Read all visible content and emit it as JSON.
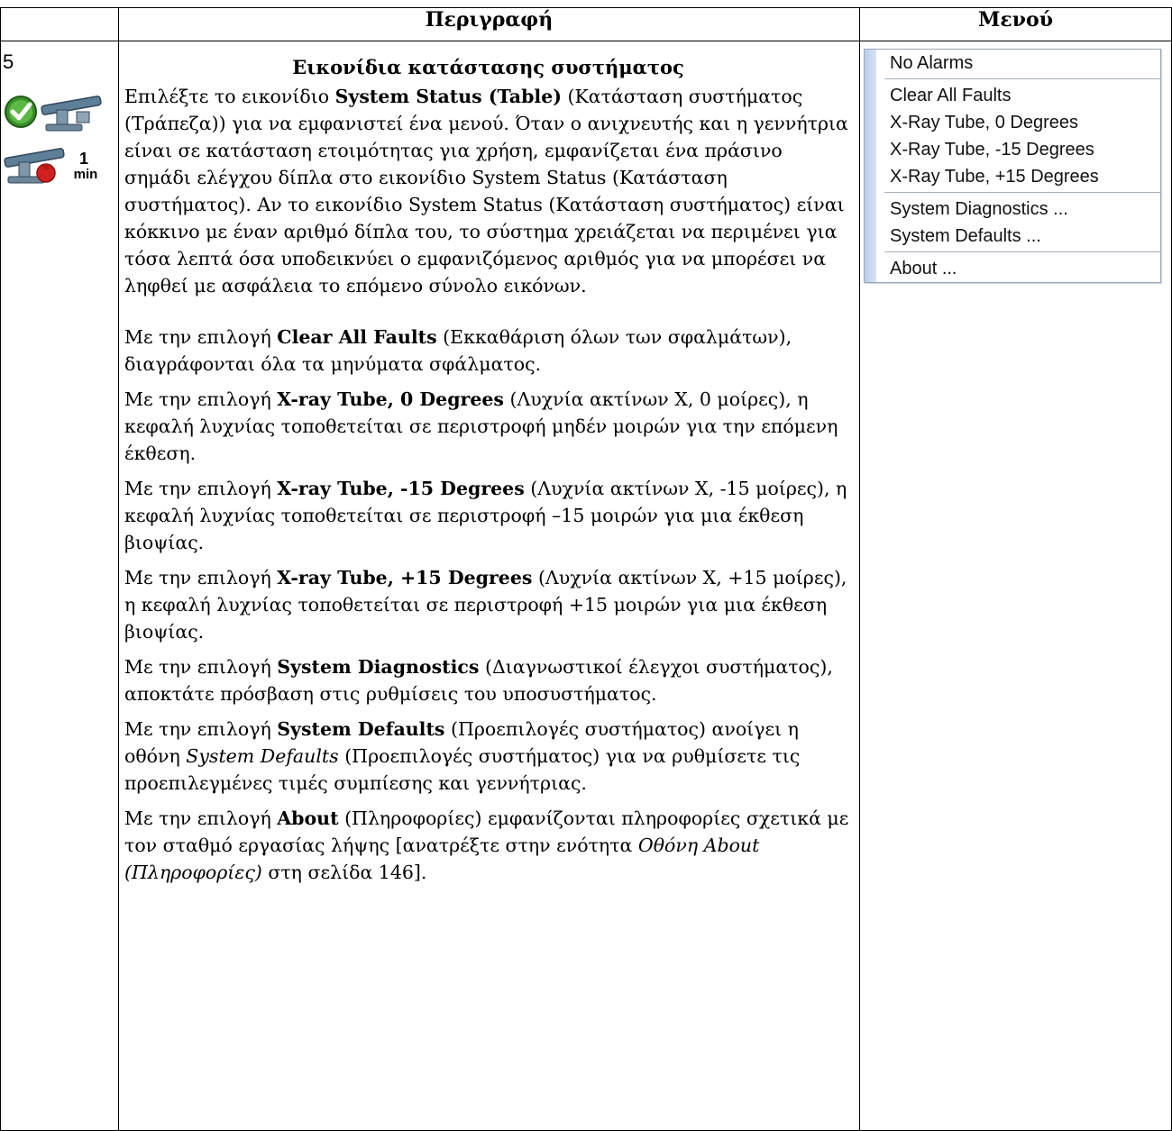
{
  "header": {
    "col_description": "Περιγραφή",
    "col_menu": "Μενού"
  },
  "row": {
    "step": "5",
    "icon2_label": {
      "num": "1",
      "unit": "min"
    },
    "title": "Εικονίδια κατάστασης συστήματος",
    "p1": {
      "a": "Επιλέξτε το εικονίδιο ",
      "b": "System Status (Table)",
      "c": " (Κατάσταση συστήματος (Τράπεζα)) για να εμφανιστεί ένα μενού. Όταν ο ανιχνευτής και η γεννήτρια είναι σε κατάσταση ετοιμότητας για χρήση, εμφανίζεται ένα πράσινο σημάδι ελέγχου δίπλα στο εικονίδιο System Status (Κατάσταση συστήματος). Αν το εικονίδιο System Status (Κατάσταση συστήματος) είναι κόκκινο με έναν αριθμό δίπλα του, το σύστημα χρειάζεται να περιμένει για τόσα λεπτά όσα υποδεικνύει ο εμφανιζόμενος αριθμός για να μπορέσει να ληφθεί με ασφάλεια το επόμενο σύνολο εικόνων."
    },
    "p2": {
      "a": "Με την επιλογή ",
      "b": "Clear All Faults",
      "c": " (Εκκαθάριση όλων των σφαλμάτων), διαγράφονται όλα τα μηνύματα σφάλματος."
    },
    "p3": {
      "a": "Με την επιλογή ",
      "b": "X-ray Tube, 0 Degrees",
      "c": " (Λυχνία ακτίνων Χ, 0 μοίρες), η κεφαλή λυχνίας τοποθετείται σε περιστροφή μηδέν μοιρών για την επόμενη έκθεση."
    },
    "p4": {
      "a": "Με την επιλογή ",
      "b": "X-ray Tube, -15 Degrees",
      "c": " (Λυχνία ακτίνων Χ, -15 μοίρες), η κεφαλή λυχνίας τοποθετείται σε περιστροφή –15 μοιρών για μια έκθεση βιοψίας."
    },
    "p5": {
      "a": "Με την επιλογή ",
      "b": "X-ray Tube, +15 Degrees",
      "c": " (Λυχνία ακτίνων Χ, +15 μοίρες), η κεφαλή λυχνίας τοποθετείται σε περιστροφή +15 μοιρών για μια έκθεση βιοψίας."
    },
    "p6": {
      "a": "Με την επιλογή ",
      "b": "System Diagnostics",
      "c": " (Διαγνωστικοί έλεγχοι συστήματος), αποκτάτε πρόσβαση στις ρυθμίσεις του υποσυστήματος."
    },
    "p7": {
      "a": "Με την επιλογή ",
      "b": "System Defaults",
      "c": " (Προεπιλογές συστήματος) ανοίγει η οθόνη ",
      "d": "System Defaults",
      "e": " (Προεπιλογές συστήματος) για να ρυθμίσετε τις προεπιλεγμένες τιμές συμπίεσης και γεννήτριας."
    },
    "p8": {
      "a": "Με την επιλογή ",
      "b": "About",
      "c": " (Πληροφορίες) εμφανίζονται πληροφορίες σχετικά με τον σταθμό εργασίας λήψης [ανατρέξτε στην ενότητα ",
      "d": "Οθόνη About (Πληροφορίες)",
      "e": " στη σελίδα 146]."
    }
  },
  "menu": {
    "items": [
      "No Alarms",
      "Clear All Faults",
      "X-Ray Tube, 0 Degrees",
      "X-Ray Tube, -15 Degrees",
      "X-Ray Tube, +15 Degrees",
      "System Diagnostics ...",
      "System Defaults ...",
      "About ..."
    ]
  }
}
